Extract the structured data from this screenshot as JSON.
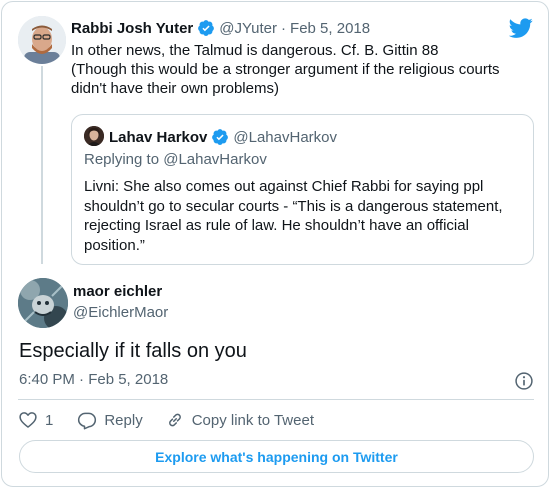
{
  "colors": {
    "brand": "#1d9bf0",
    "text_primary": "#0f1419",
    "text_secondary": "#536471",
    "border": "#cfd9de"
  },
  "parent_tweet": {
    "author_name": "Rabbi Josh Yuter",
    "handle": "@JYuter",
    "separator": "·",
    "date": "Feb 5, 2018",
    "text_lines": [
      "In other news, the Talmud is dangerous. Cf. B. Gittin 88",
      "(Though this would be a stronger argument if the religious courts",
      "didn't have their own problems)"
    ],
    "verified_icon": "verified-badge-icon",
    "brand_icon": "twitter-bird-icon"
  },
  "quoted_tweet": {
    "author_name": "Lahav Harkov",
    "handle": "@LahavHarkov",
    "replying_to": "Replying to @LahavHarkov",
    "text_lines": [
      "Livni: She also comes out against Chief Rabbi for saying ppl",
      "shouldn’t go to secular courts - “This is a dangerous statement,",
      "rejecting Israel as rule of law. He shouldn’t have an official",
      "position.”"
    ],
    "verified_icon": "verified-badge-icon"
  },
  "main_tweet": {
    "author_name": "maor eichler",
    "handle": "@EichlerMaor",
    "text": "Especially if it falls on you",
    "timestamp": "6:40 PM · Feb 5, 2018",
    "info_icon": "info-icon"
  },
  "actions": {
    "like_count": "1",
    "reply_label": "Reply",
    "copy_link_label": "Copy link to Tweet",
    "icons": [
      "heart-icon",
      "reply-bubble-icon",
      "link-icon"
    ]
  },
  "explore_button": {
    "label": "Explore what's happening on Twitter"
  }
}
